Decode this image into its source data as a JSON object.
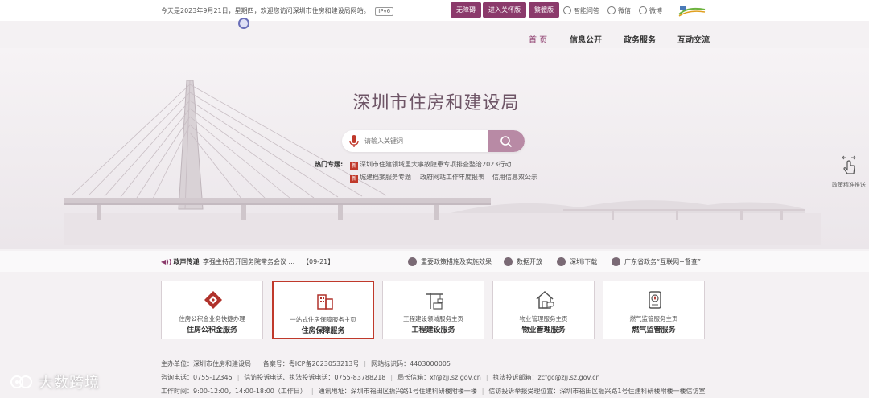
{
  "topbar": {
    "welcome": "今天是2023年9月21日，星期四，欢迎您访问深圳市住房和建设局网站。",
    "ipv6": "IPv6",
    "buttons": [
      "无障碍",
      "进入关怀版",
      "繁體版"
    ],
    "links": [
      "智能问答",
      "微信",
      "微博"
    ]
  },
  "nav": [
    "首 页",
    "信息公开",
    "政务服务",
    "互动交流"
  ],
  "hero": {
    "title": "深圳市住房和建设局",
    "search_placeholder": "请输入关键词",
    "hot_label": "热门专题:",
    "hot_items": [
      "深圳市住建领域重大事故隐患专项排查整治2023行动",
      "城建档案服务专题",
      "政府网站工作年度报表",
      "信用信息双公示"
    ],
    "side_widget": "政策精准推送"
  },
  "strip": {
    "news_label": "政声传递",
    "news_text": "李强主持召开国务院常务会议 ...",
    "news_date": "【09-21】",
    "quick_links": [
      "重要政策措施及实施效果",
      "数据开放",
      "深圳i下载",
      "广东省政务“互联网+督查”"
    ]
  },
  "cards": [
    {
      "sub": "住房公积金业务快捷办理",
      "title": "住房公积金服务"
    },
    {
      "sub": "一站式住房保障服务主页",
      "title": "住房保障服务"
    },
    {
      "sub": "工程建设领域服务主页",
      "title": "工程建设服务"
    },
    {
      "sub": "物业管理服务主页",
      "title": "物业管理服务"
    },
    {
      "sub": "燃气监管服务主页",
      "title": "燃气监管服务"
    }
  ],
  "footer": {
    "line1": [
      "主办单位：深圳市住房和建设局",
      "备案号：粤ICP备2023053213号",
      "网站标识码：4403000005"
    ],
    "line2": [
      "咨询电话：0755-12345",
      "信访投诉电话、执法投诉电话：0755-83788218",
      "局长信箱：xf@zjj.sz.gov.cn",
      "执法投诉邮箱：zcfgc@zjj.sz.gov.cn"
    ],
    "line3": [
      "工作时间：9:00-12:00，14:00-18:00（工作日）",
      "通讯地址：深圳市福田区振兴路1号住建科研楼附楼一楼",
      "信访投诉举报受理位置：深圳市福田区振兴路1号住建科研楼附楼一楼信访室"
    ]
  },
  "watermark": "大数跨境",
  "colors": {
    "accent": "#8b3a6b",
    "highlight": "#c0392b",
    "search_button": "#b88aa5"
  }
}
